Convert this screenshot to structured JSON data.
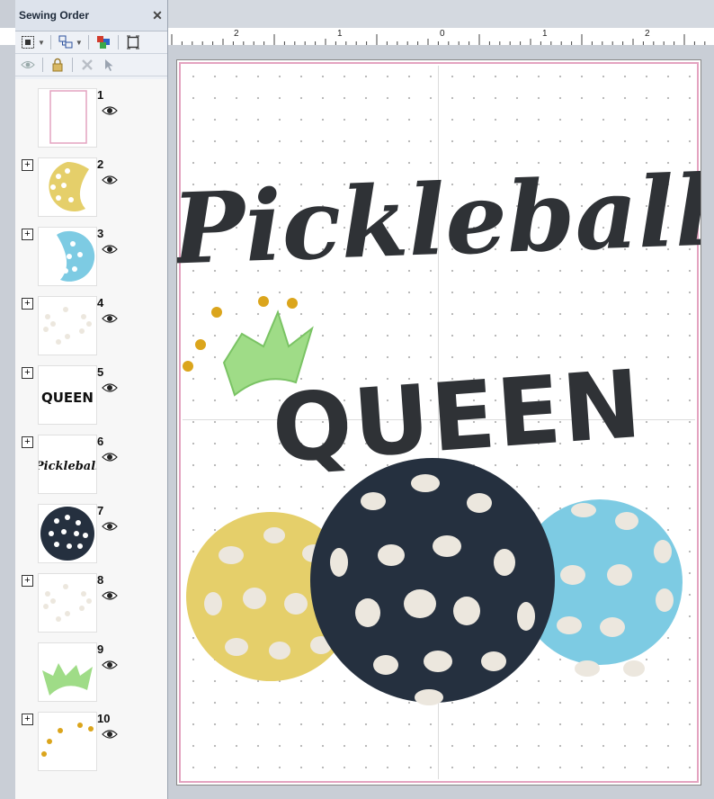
{
  "panel": {
    "title": "Sewing Order",
    "close_glyph": "✕",
    "toolbar1": [
      "select-frame-icon",
      "group-icon",
      "color-sort-icon",
      "fit-frame-icon"
    ],
    "toolbar2": [
      "visibility-icon",
      "lock-icon",
      "delete-icon",
      "pointer-icon"
    ]
  },
  "ruler": {
    "labels": [
      "2",
      "1",
      "0",
      "1",
      "2"
    ]
  },
  "sewing_items": [
    {
      "num": "1",
      "expandable": false,
      "thumb": "frame"
    },
    {
      "num": "2",
      "expandable": true,
      "thumb": "yellow-ball"
    },
    {
      "num": "3",
      "expandable": true,
      "thumb": "blue-ball"
    },
    {
      "num": "4",
      "expandable": true,
      "thumb": "dots"
    },
    {
      "num": "5",
      "expandable": true,
      "thumb": "queen-text",
      "thumb_text": "QUEEN"
    },
    {
      "num": "6",
      "expandable": true,
      "thumb": "pickleball-text",
      "thumb_text": "Pickleball"
    },
    {
      "num": "7",
      "expandable": false,
      "thumb": "navy-ball"
    },
    {
      "num": "8",
      "expandable": true,
      "thumb": "dots"
    },
    {
      "num": "9",
      "expandable": false,
      "thumb": "crown"
    },
    {
      "num": "10",
      "expandable": true,
      "thumb": "crown-dots"
    }
  ],
  "design": {
    "script_text": "Pickleball",
    "block_text": "QUEEN",
    "colors": {
      "thread_dark": "#2f3236",
      "yellow": "#e5cf6a",
      "blue": "#7dcbe3",
      "navy": "#25303f",
      "spot": "#ece7de",
      "crown_green": "#9fdc87",
      "crown_gold": "#dba51c",
      "hoop_edge": "#e4a3c0"
    }
  }
}
